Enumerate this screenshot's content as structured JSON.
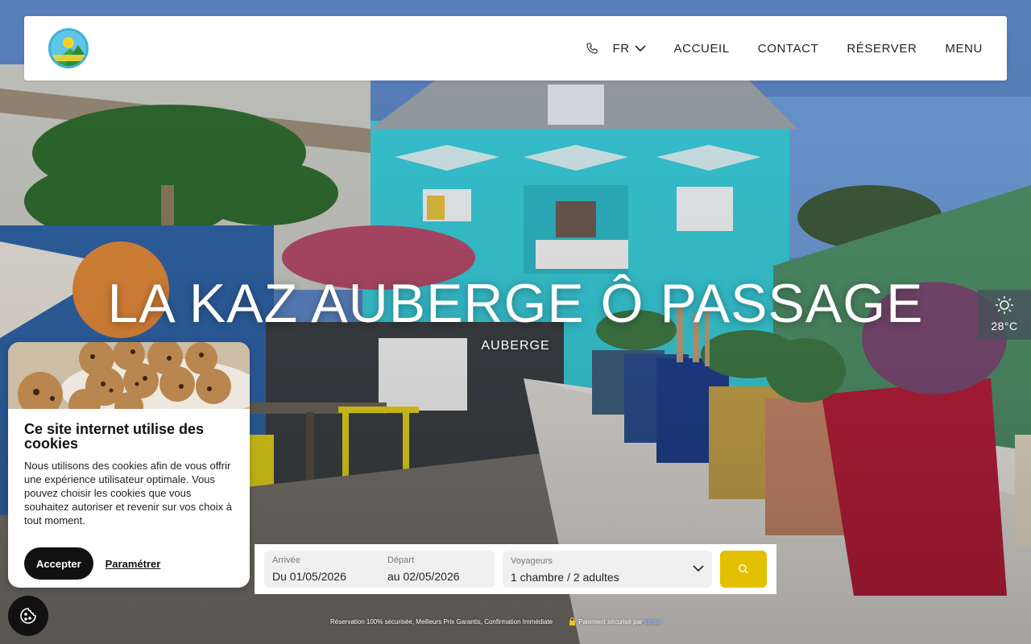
{
  "header": {
    "logo_alt": "La Kaz Auberge Ô Passage logo",
    "lang_label": "FR",
    "nav": [
      "ACCUEIL",
      "CONTACT",
      "RÉSERVER",
      "MENU"
    ]
  },
  "hero": {
    "title": "LA KAZ AUBERGE Ô PASSAGE",
    "subtitle": "AUBERGE"
  },
  "weather": {
    "icon": "sun-icon",
    "temperature": "28°C"
  },
  "cookie_banner": {
    "title": "Ce site internet utilise des cookies",
    "text": "Nous utilisons des cookies afin de vous offrir une expérience utilisateur optimale. Vous pouvez choisir les cookies que vous souhaitez autoriser et revenir sur vos choix à tout moment.",
    "accept_label": "Accepter",
    "settings_label": "Paramétrer"
  },
  "booking": {
    "arrival_label": "Arrivée",
    "arrival_value": "Du 01/05/2026",
    "departure_label": "Départ",
    "departure_value": "au 02/05/2026",
    "guests_label": "Voyageurs",
    "guests_value": "1 chambre / 2 adultes",
    "search_icon": "search-icon",
    "accent_color": "#e2c000"
  },
  "footnote": {
    "guarantees": "Réservation 100% sécurisée, Meilleurs Prix Garantis, Confirmation Immédiate",
    "payment": "Paiement sécurisé par",
    "provider": "stripe"
  }
}
